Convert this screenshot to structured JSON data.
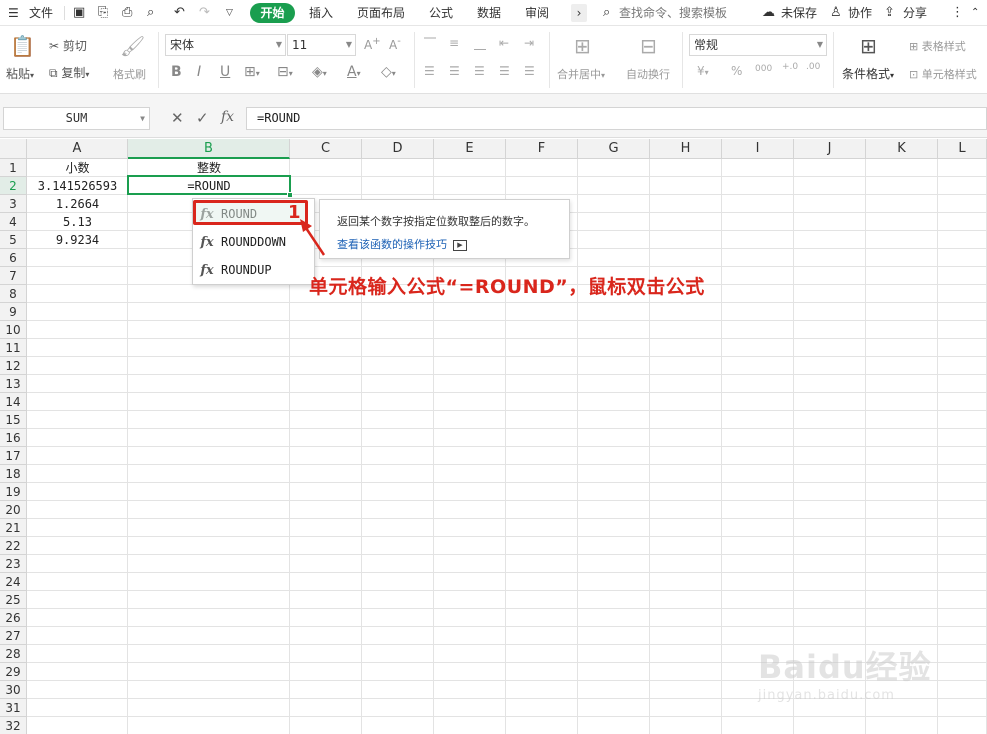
{
  "menubar": {
    "file": "文件",
    "tabs": [
      "开始",
      "插入",
      "页面布局",
      "公式",
      "数据",
      "审阅"
    ],
    "search": "查找命令、搜索模板",
    "unsaved": "未保存",
    "collab": "协作",
    "share": "分享"
  },
  "ribbon": {
    "paste": "粘贴",
    "cut": "剪切",
    "copy": "复制",
    "format_painter": "格式刷",
    "font_name": "宋体",
    "font_size": "11",
    "merge_center": "合并居中",
    "wrap_text": "自动换行",
    "number_format": "常规",
    "cond_format": "条件格式",
    "table_style": "表格样式",
    "cell_style": "单元格样式"
  },
  "formula_bar": {
    "name_box": "SUM",
    "fx": "fx",
    "formula": "=ROUND"
  },
  "grid": {
    "columns": [
      "A",
      "B",
      "C",
      "D",
      "E",
      "F",
      "G",
      "H",
      "I",
      "J",
      "K",
      "L"
    ],
    "rows": [
      "1",
      "2",
      "3",
      "4",
      "5",
      "6",
      "7",
      "8",
      "9",
      "10",
      "11",
      "12",
      "13",
      "14",
      "15",
      "16",
      "17",
      "18",
      "19",
      "20",
      "21",
      "22",
      "23",
      "24",
      "25",
      "26",
      "27",
      "28",
      "29",
      "30",
      "31",
      "32"
    ],
    "cells": [
      {
        "ref": "A1",
        "text": "小数"
      },
      {
        "ref": "B1",
        "text": "整数"
      },
      {
        "ref": "A2",
        "text": "3.141526593"
      },
      {
        "ref": "B2",
        "text": "=ROUND"
      },
      {
        "ref": "A3",
        "text": "1.2664"
      },
      {
        "ref": "A4",
        "text": "5.13"
      },
      {
        "ref": "A5",
        "text": "9.9234"
      }
    ]
  },
  "autocomplete": {
    "items": [
      "ROUND",
      "ROUNDDOWN",
      "ROUNDUP"
    ],
    "fx": "fx",
    "description": "返回某个数字按指定位数取整后的数字。",
    "link": "查看该函数的操作技巧"
  },
  "annotation": {
    "step": "1",
    "text": "单元格输入公式“=ROUND”，鼠标双击公式"
  },
  "watermark": {
    "main": "Baidu经验",
    "sub": "jingyan.baidu.com"
  },
  "colors": {
    "accent": "#1a9e4f",
    "annotation": "#d9261c",
    "link": "#1a5fb4"
  }
}
